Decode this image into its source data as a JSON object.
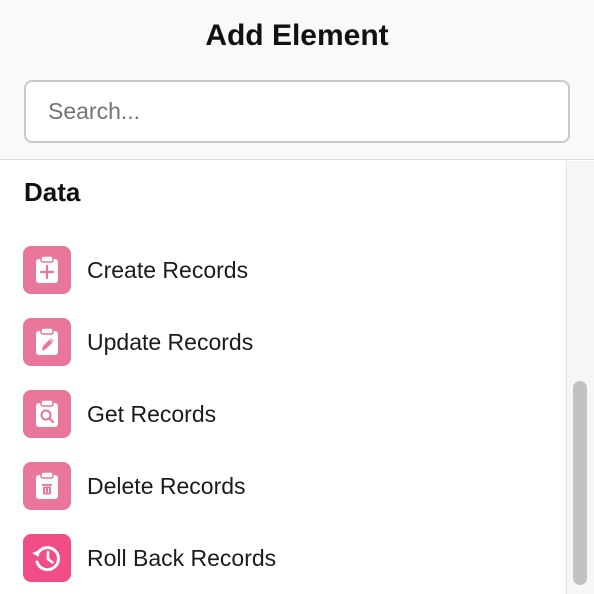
{
  "header": {
    "title": "Add Element"
  },
  "search": {
    "placeholder": "Search...",
    "value": ""
  },
  "section": {
    "title": "Data",
    "items": [
      {
        "label": "Create Records",
        "icon": "clipboard-plus-icon"
      },
      {
        "label": "Update Records",
        "icon": "clipboard-pencil-icon"
      },
      {
        "label": "Get Records",
        "icon": "clipboard-search-icon"
      },
      {
        "label": "Delete Records",
        "icon": "clipboard-trash-icon"
      },
      {
        "label": "Roll Back Records",
        "icon": "history-icon"
      }
    ]
  },
  "colors": {
    "icon_pink": "#e9779a",
    "icon_rollback": "#f14d86",
    "header_bg": "#faf9f7"
  }
}
